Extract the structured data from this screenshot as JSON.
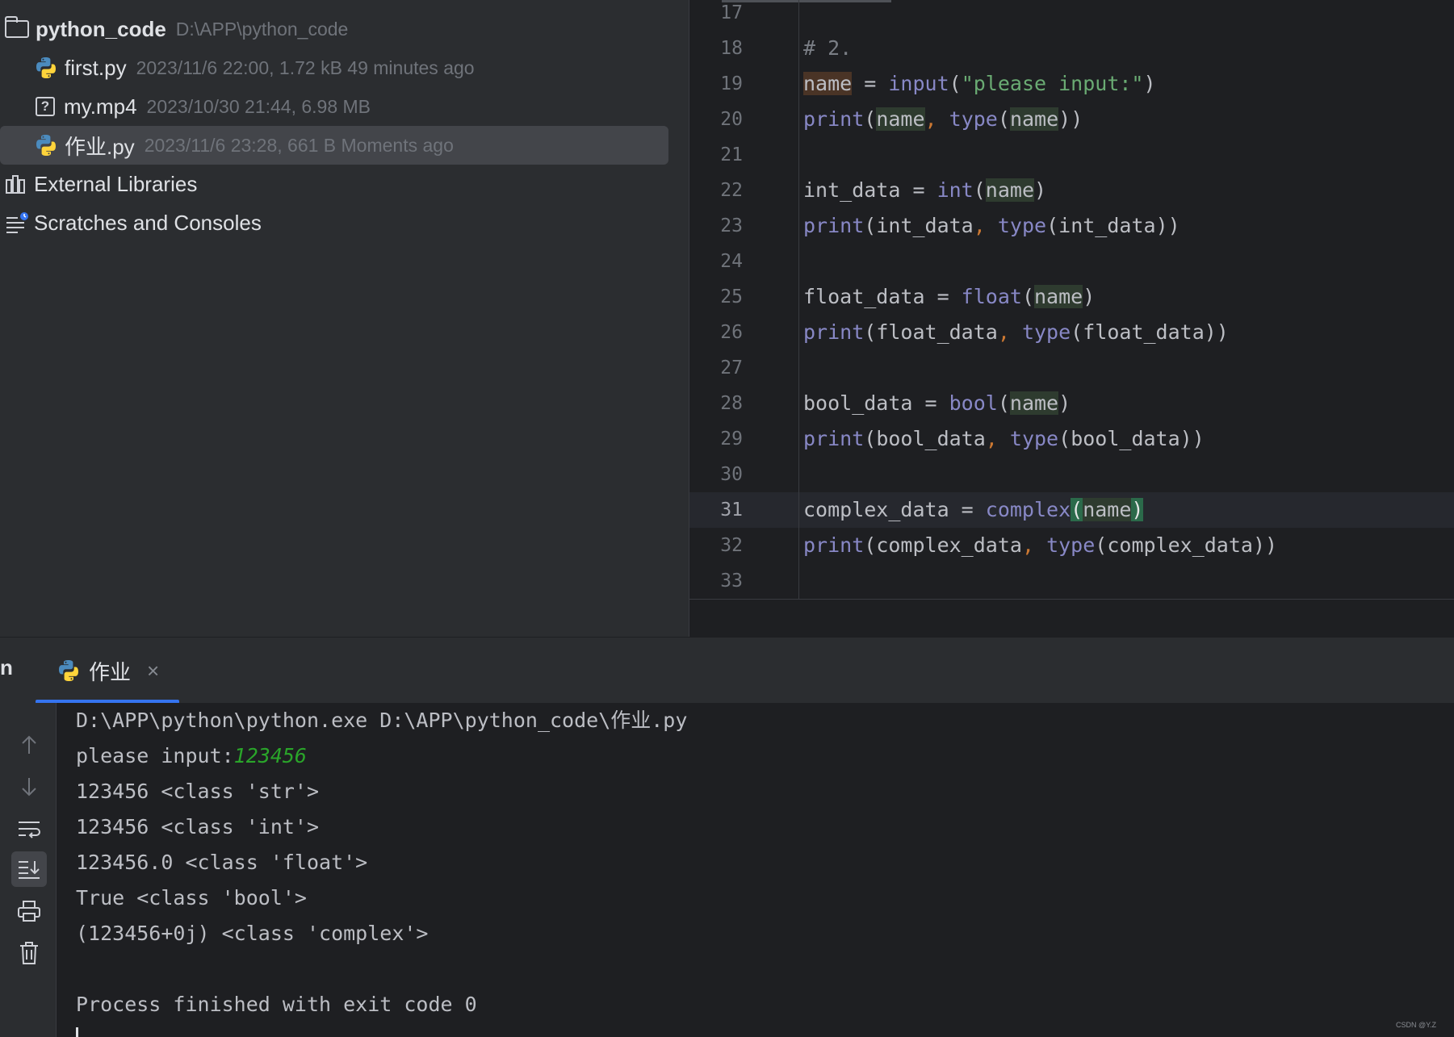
{
  "project": {
    "root": {
      "name": "python_code",
      "path": "D:\\APP\\python_code"
    },
    "files": [
      {
        "name": "first.py",
        "meta": "2023/11/6 22:00, 1.72 kB 49 minutes ago",
        "icon": "python-file-icon"
      },
      {
        "name": "my.mp4",
        "meta": "2023/10/30 21:44, 6.98 MB",
        "icon": "unknown-file-icon"
      },
      {
        "name": "作业.py",
        "meta": "2023/11/6 23:28, 661 B Moments ago",
        "icon": "python-file-icon",
        "selected": true
      }
    ],
    "external_libraries": "External Libraries",
    "scratches": "Scratches and Consoles"
  },
  "editor": {
    "line_numbers": [
      "17",
      "18",
      "19",
      "20",
      "21",
      "22",
      "23",
      "24",
      "25",
      "26",
      "27",
      "28",
      "29",
      "30",
      "31",
      "32",
      "33"
    ],
    "current_line": "31",
    "code": {
      "l18": "# 2.",
      "name": "name",
      "assign": " = ",
      "input": "input",
      "prompt_str": "\"please input:\"",
      "print": "print",
      "type": "type",
      "int_data": "int_data",
      "int": "int",
      "float_data": "float_data",
      "float": "float",
      "bool_data": "bool_data",
      "bool": "bool",
      "complex_data": "complex_data",
      "complex": "complex",
      "lp": "(",
      "rp": ")",
      "rpp": "))",
      "comma": ", "
    }
  },
  "run": {
    "cut_label": "n",
    "tab_label": "作业",
    "console_lines": [
      "D:\\APP\\python\\python.exe D:\\APP\\python_code\\作业.py",
      "please input:",
      "123456 <class 'str'>",
      "123456 <class 'int'>",
      "123456.0 <class 'float'>",
      "True <class 'bool'>",
      "(123456+0j) <class 'complex'>",
      "",
      "Process finished with exit code 0"
    ],
    "user_input": "123456"
  },
  "watermark": "CSDN @Y.Z"
}
